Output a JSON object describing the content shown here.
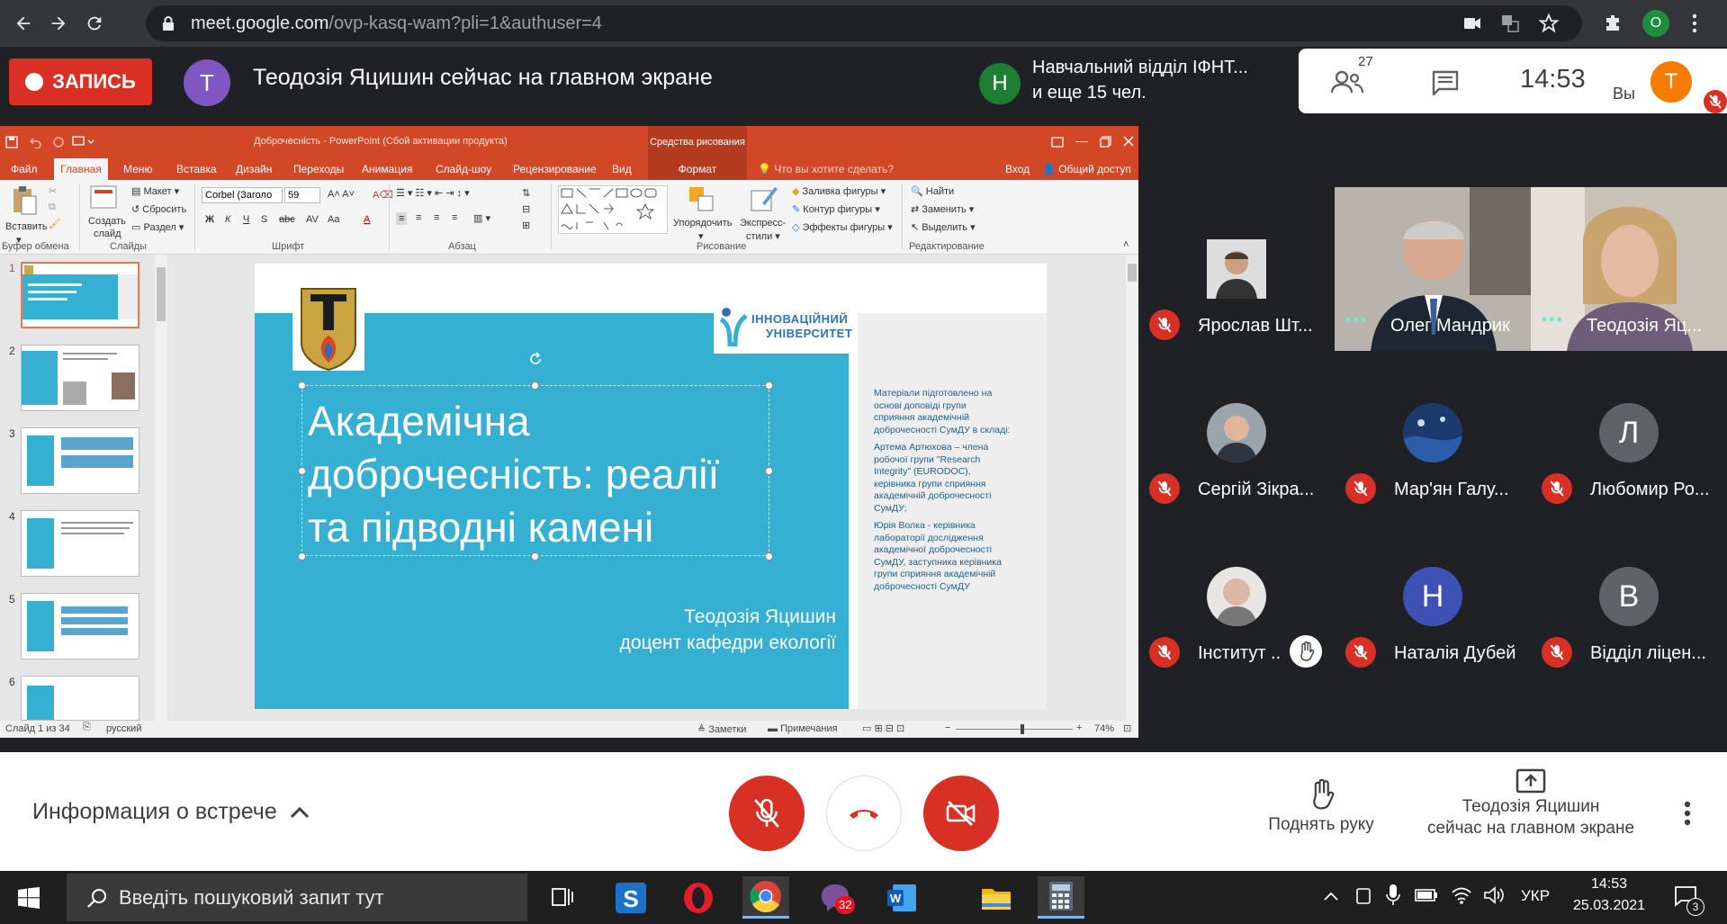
{
  "browser": {
    "url_host": "meet.google.com",
    "url_path": "/ovp-kasq-wam?pli=1&authuser=4",
    "profile_letter": "O"
  },
  "meet": {
    "record_label": "ЗАПИСЬ",
    "presenter_letter": "T",
    "presenting_text": "Теодозія Яцишин сейчас на главном экране",
    "notif_letter": "Н",
    "notif_line1": "Навчальний відділ ІФНТ...",
    "notif_line2": "и еще 15 чел.",
    "participants_count": "27",
    "time": "14:53",
    "you_label": "Вы",
    "you_letter": "T"
  },
  "ppt": {
    "title": "Доброчесність - PowerPoint (Сбой активации продукта)",
    "drawing_tools": "Средства рисования",
    "tabs": [
      "Файл",
      "Главная",
      "Меню",
      "Вставка",
      "Дизайн",
      "Переходы",
      "Анимация",
      "Слайд-шоу",
      "Рецензирование",
      "Вид"
    ],
    "format_tab": "Формат",
    "tellme": "Что вы хотите сделать?",
    "signin": "Вход",
    "share": "Общий доступ",
    "ribbon": {
      "paste": "Вставить",
      "clipboard": "Буфер обмена",
      "create_slide_1": "Создать",
      "create_slide_2": "слайд",
      "layout": "Макет",
      "reset": "Сбросить",
      "section": "Раздел",
      "slides": "Слайды",
      "font_name": "Corbel (Заголо",
      "font_size": "59",
      "font": "Шрифт",
      "paragraph": "Абзац",
      "arrange": "Упорядочить",
      "quick_styles_1": "Экспресс-",
      "quick_styles_2": "стили",
      "shape_fill": "Заливка фигуры",
      "shape_outline": "Контур фигуры",
      "shape_effects": "Эффекты фигуры",
      "drawing": "Рисование",
      "find": "Найти",
      "replace": "Заменить",
      "select": "Выделить",
      "editing": "Редактирование"
    },
    "thumb_numbers": [
      "1",
      "2",
      "3",
      "4",
      "5",
      "6"
    ],
    "slide": {
      "logo_text": "ІННОВАЦІЙНИЙ УНІВЕРСИТЕТ",
      "logo_line1": "ІННОВАЦІЙНИЙ",
      "logo_line2": "УНІВЕРСИТЕТ",
      "title_line1": "Академічна",
      "title_line2": "доброчесність: реалії",
      "title_line3": "та підводні камені",
      "author": "Теодозія Яцишин",
      "position": "доцент кафедри екології",
      "side_p1_l1": "Матеріали підготовлено на",
      "side_p1_l2": "основі доповіді групи",
      "side_p1_l3": "сприяння академічній",
      "side_p1_l4": "доброчесності СумДУ в складі:",
      "side_p2_l1": "Артема Артюхова – члена",
      "side_p2_l2": "робочої групи \"Research",
      "side_p2_l3": "Integrity\" (EURODOC),",
      "side_p2_l4": "керівника групи сприяння",
      "side_p2_l5": "академічній доброчесності",
      "side_p2_l6": "СумДУ;",
      "side_p3_l1": "Юрія Волка - керівника",
      "side_p3_l2": "лабораторії дослідження",
      "side_p3_l3": "академічної доброчесності",
      "side_p3_l4": "СумДУ, заступника керівника",
      "side_p3_l5": "групи сприяння академічній",
      "side_p3_l6": "доброчесності СумДУ"
    },
    "status": {
      "slide_of": "Слайд 1 из 34",
      "language": "русский",
      "notes": "Заметки",
      "comments": "Примечания",
      "zoom": "74%"
    }
  },
  "participants": [
    {
      "name": "Ярослав Шт...",
      "letter": "",
      "muted": true
    },
    {
      "name": "Олег Мандрик",
      "letter": "",
      "muted": false
    },
    {
      "name": "Теодозія Яц...",
      "letter": "",
      "muted": false
    },
    {
      "name": "Сергій Зікра...",
      "letter": "",
      "muted": true
    },
    {
      "name": "Мар'ян Галу...",
      "letter": "",
      "muted": true
    },
    {
      "name": "Любомир Ро...",
      "letter": "Л",
      "muted": true
    },
    {
      "name": "Інститут ...",
      "letter": "",
      "muted": true
    },
    {
      "name": "Наталія Дубей",
      "letter": "Н",
      "muted": true
    },
    {
      "name": "Відділ ліцен...",
      "letter": "В",
      "muted": true
    }
  ],
  "bottom": {
    "meeting_info": "Информация о встрече",
    "raise_hand": "Поднять руку",
    "presenting_line1": "Теодозія Яцишин",
    "presenting_line2": "сейчас на главном экране"
  },
  "taskbar": {
    "search_placeholder": "Введіть пошуковий запит тут",
    "viber_badge": "32",
    "lang": "УКР",
    "time": "14:53",
    "date": "25.03.2021",
    "notif_count": "3"
  },
  "colors": {
    "accent_red": "#d93025",
    "ppt_orange": "#d24726",
    "slide_blue": "#35b0d2",
    "meet_bg": "#202124"
  }
}
